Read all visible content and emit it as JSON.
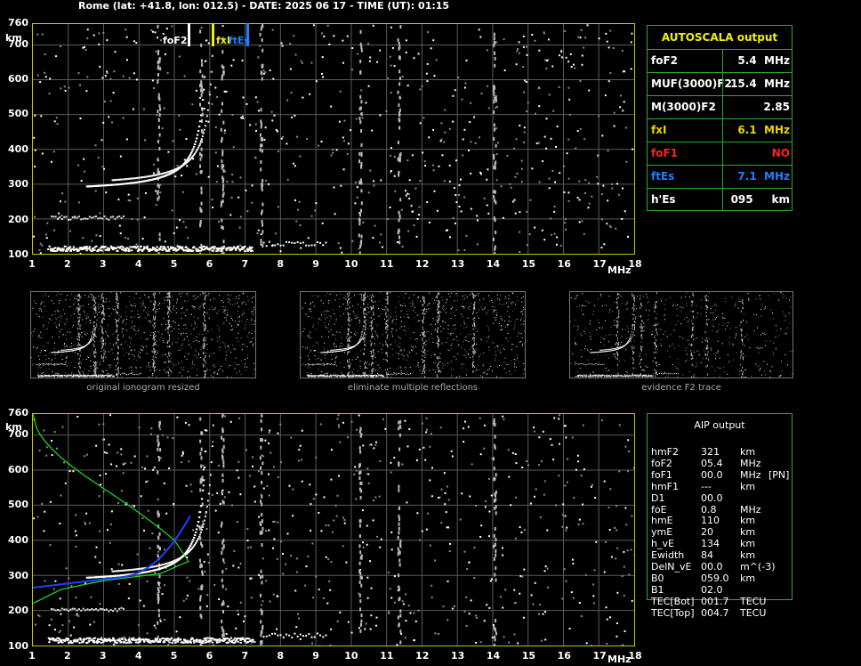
{
  "header": "Rome (lat: +41.8, lon: 012.5) - DATE: 2025 06 17 - TIME (UT): 01:15",
  "axes": {
    "y_ticks": [
      "760",
      "700",
      "600",
      "500",
      "400",
      "300",
      "200",
      "100"
    ],
    "y_unit": "km",
    "x_ticks": [
      "1",
      "2",
      "3",
      "4",
      "5",
      "6",
      "7",
      "8",
      "9",
      "10",
      "11",
      "12",
      "13",
      "14",
      "15",
      "16",
      "17",
      "18"
    ],
    "x_unit": "MHz"
  },
  "markers": {
    "foF2": "foF2",
    "fxI": "fxI",
    "ftEs": "ftEs"
  },
  "colors": {
    "yellow": "#f0f000",
    "red": "#ff2020",
    "blue": "#2080ff",
    "green": "#2fa82f",
    "axis": "#c8c800"
  },
  "autoscala": {
    "title": "AUTOSCALA output",
    "rows": [
      {
        "key": "foF2",
        "value": "5.4  MHz",
        "color": "#ffffff"
      },
      {
        "key": "MUF(3000)F2",
        "value": "15.4  MHz",
        "color": "#ffffff"
      },
      {
        "key": "M(3000)F2",
        "value": "2.85",
        "color": "#ffffff"
      },
      {
        "key": "fxI",
        "value": "6.1  MHz",
        "color": "#e8d800"
      },
      {
        "key": "foF1",
        "value": "NO",
        "color": "#ff2020"
      },
      {
        "key": "ftEs",
        "value": "7.1  MHz",
        "color": "#2080ff"
      },
      {
        "key": "h'Es",
        "value": "095     km",
        "color": "#ffffff"
      }
    ]
  },
  "thumbs": {
    "cap1": "original ionogram resized",
    "cap2": "eliminate multiple reflections",
    "cap3": "evidence F2 trace"
  },
  "aip": {
    "title": "AIP output",
    "rows": [
      [
        "hmF2",
        "321",
        "km",
        ""
      ],
      [
        "foF2",
        "05.4",
        "MHz",
        ""
      ],
      [
        "foF1",
        "00.0",
        "MHz",
        "[PN]"
      ],
      [
        "hmF1",
        "---",
        "km",
        ""
      ],
      [
        "D1",
        "00.0",
        "",
        ""
      ],
      [
        "foE",
        "0.8",
        "MHz",
        ""
      ],
      [
        "hmE",
        "110",
        "km",
        ""
      ],
      [
        "ymE",
        "20",
        "km",
        ""
      ],
      [
        "h_vE",
        "134",
        "km",
        ""
      ],
      [
        "Ewidth",
        "84",
        "km",
        ""
      ],
      [
        "DelN_vE",
        "00.0",
        "m^(-3)",
        ""
      ],
      [
        "B0",
        "059.0",
        "km",
        ""
      ],
      [
        "B1",
        "02.0",
        "",
        ""
      ],
      [
        "TEC[Bot]",
        "001.7",
        "TECU",
        ""
      ],
      [
        "TEC[Top]",
        "004.7",
        "TECU",
        ""
      ]
    ]
  }
}
